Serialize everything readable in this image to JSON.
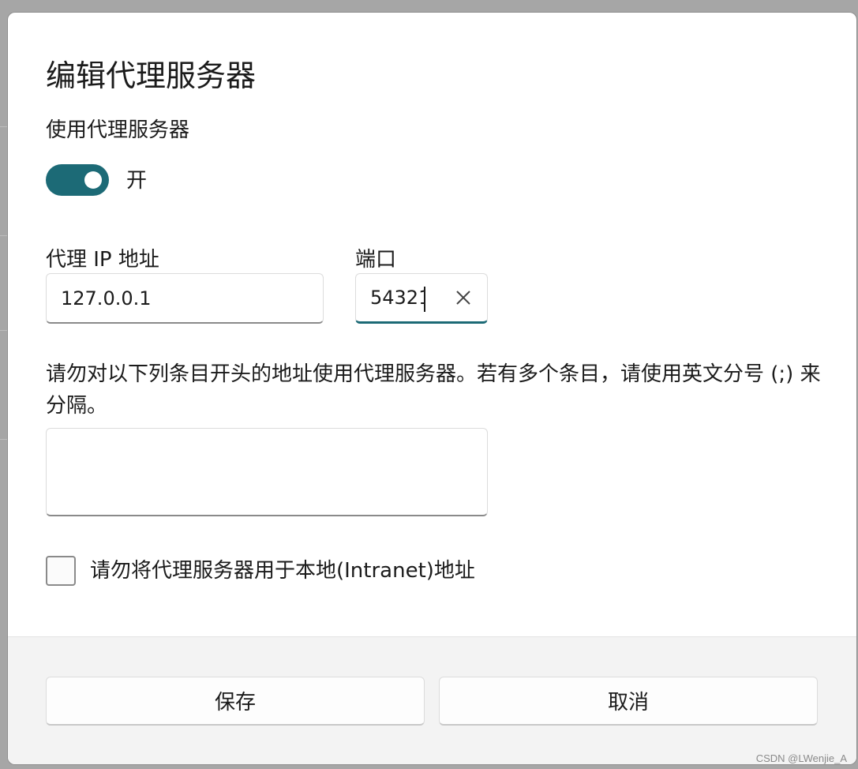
{
  "dialog": {
    "title": "编辑代理服务器"
  },
  "proxy_toggle": {
    "label": "使用代理服务器",
    "state_text": "开",
    "on": true,
    "color": "#1c6a76"
  },
  "ip_field": {
    "label": "代理 IP 地址",
    "value": "127.0.0.1"
  },
  "port_field": {
    "label": "端口",
    "value": "54321",
    "clear_icon": "close-icon"
  },
  "exceptions": {
    "description": "请勿对以下列条目开头的地址使用代理服务器。若有多个条目，请使用英文分号 (;) 来分隔。",
    "value": ""
  },
  "local_bypass": {
    "label": "请勿将代理服务器用于本地(Intranet)地址",
    "checked": false
  },
  "footer": {
    "save_label": "保存",
    "cancel_label": "取消"
  },
  "watermark": "CSDN @LWenjie_A"
}
